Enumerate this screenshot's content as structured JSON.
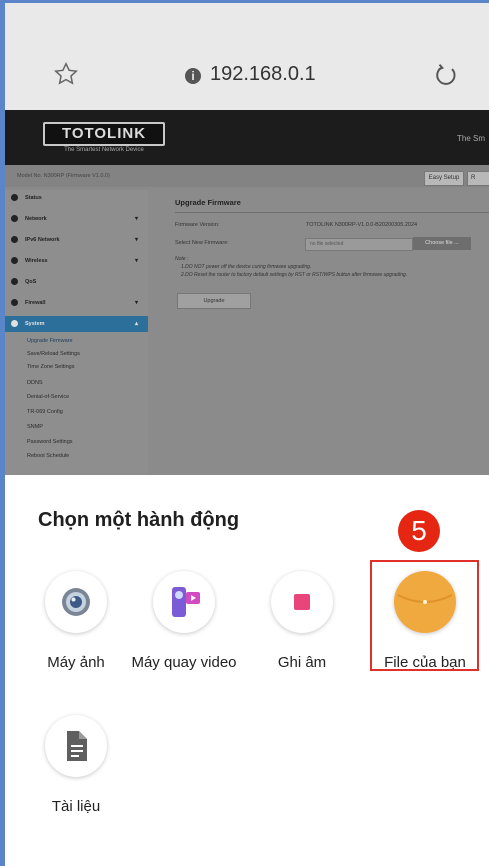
{
  "browser": {
    "url": "192.168.0.1"
  },
  "router": {
    "brand": "TOTOLINK",
    "brand_tagline": "The Smartest Network Device",
    "header_right": "The Sm",
    "model_line": "Model No. N300RP (Firmware V1.0.0)",
    "easy_setup": "Easy Setup",
    "easy_setup_cut": "R",
    "menu": [
      {
        "label": "Status",
        "arrow": ""
      },
      {
        "label": "Network",
        "arrow": "▾"
      },
      {
        "label": "IPv6 Network",
        "arrow": "▾"
      },
      {
        "label": "Wireless",
        "arrow": "▾"
      },
      {
        "label": "QoS",
        "arrow": ""
      },
      {
        "label": "Firewall",
        "arrow": "▾"
      },
      {
        "label": "System",
        "arrow": "▴"
      }
    ],
    "submenu": [
      "Upgrade Firmware",
      "Save/Reload Settings",
      "Time Zone Settings",
      "DDNS",
      "Denial-of-Service",
      "TR-069 Config",
      "SNMP",
      "Password Settings",
      "Reboot Schedule"
    ],
    "content": {
      "title": "Upgrade Firmware",
      "firmware_label": "Firmware Version:",
      "firmware_value": "TOTOLINK N300RP-V1.0.0-B20200305.2024",
      "select_label": "Select New Firmware:",
      "file_placeholder": "no file selected",
      "choose_btn": "Choose file ...",
      "note_title": "Note :",
      "note1": "1.DO NOT power off the device curing firmware upgrading.",
      "note2": "2.DO Reset the router to factory default settings by RST or RST/WPS button after firmware upgrading.",
      "upgrade_btn": "Upgrade"
    }
  },
  "sheet": {
    "title": "Chọn một hành động",
    "step_badge": "5",
    "actions": [
      {
        "label": "Máy ảnh",
        "icon": "camera-icon"
      },
      {
        "label": "Máy quay video",
        "icon": "video-camera-icon"
      },
      {
        "label": "Ghi âm",
        "icon": "sound-recorder-icon"
      },
      {
        "label": "File của bạn",
        "icon": "files-folder-icon"
      },
      {
        "label": "Tài liệu",
        "icon": "documents-icon"
      }
    ]
  },
  "colors": {
    "highlight": "#e0302a",
    "badge": "#e52613",
    "active_menu": "#2c6f9a",
    "folder": "#f0a93e"
  }
}
